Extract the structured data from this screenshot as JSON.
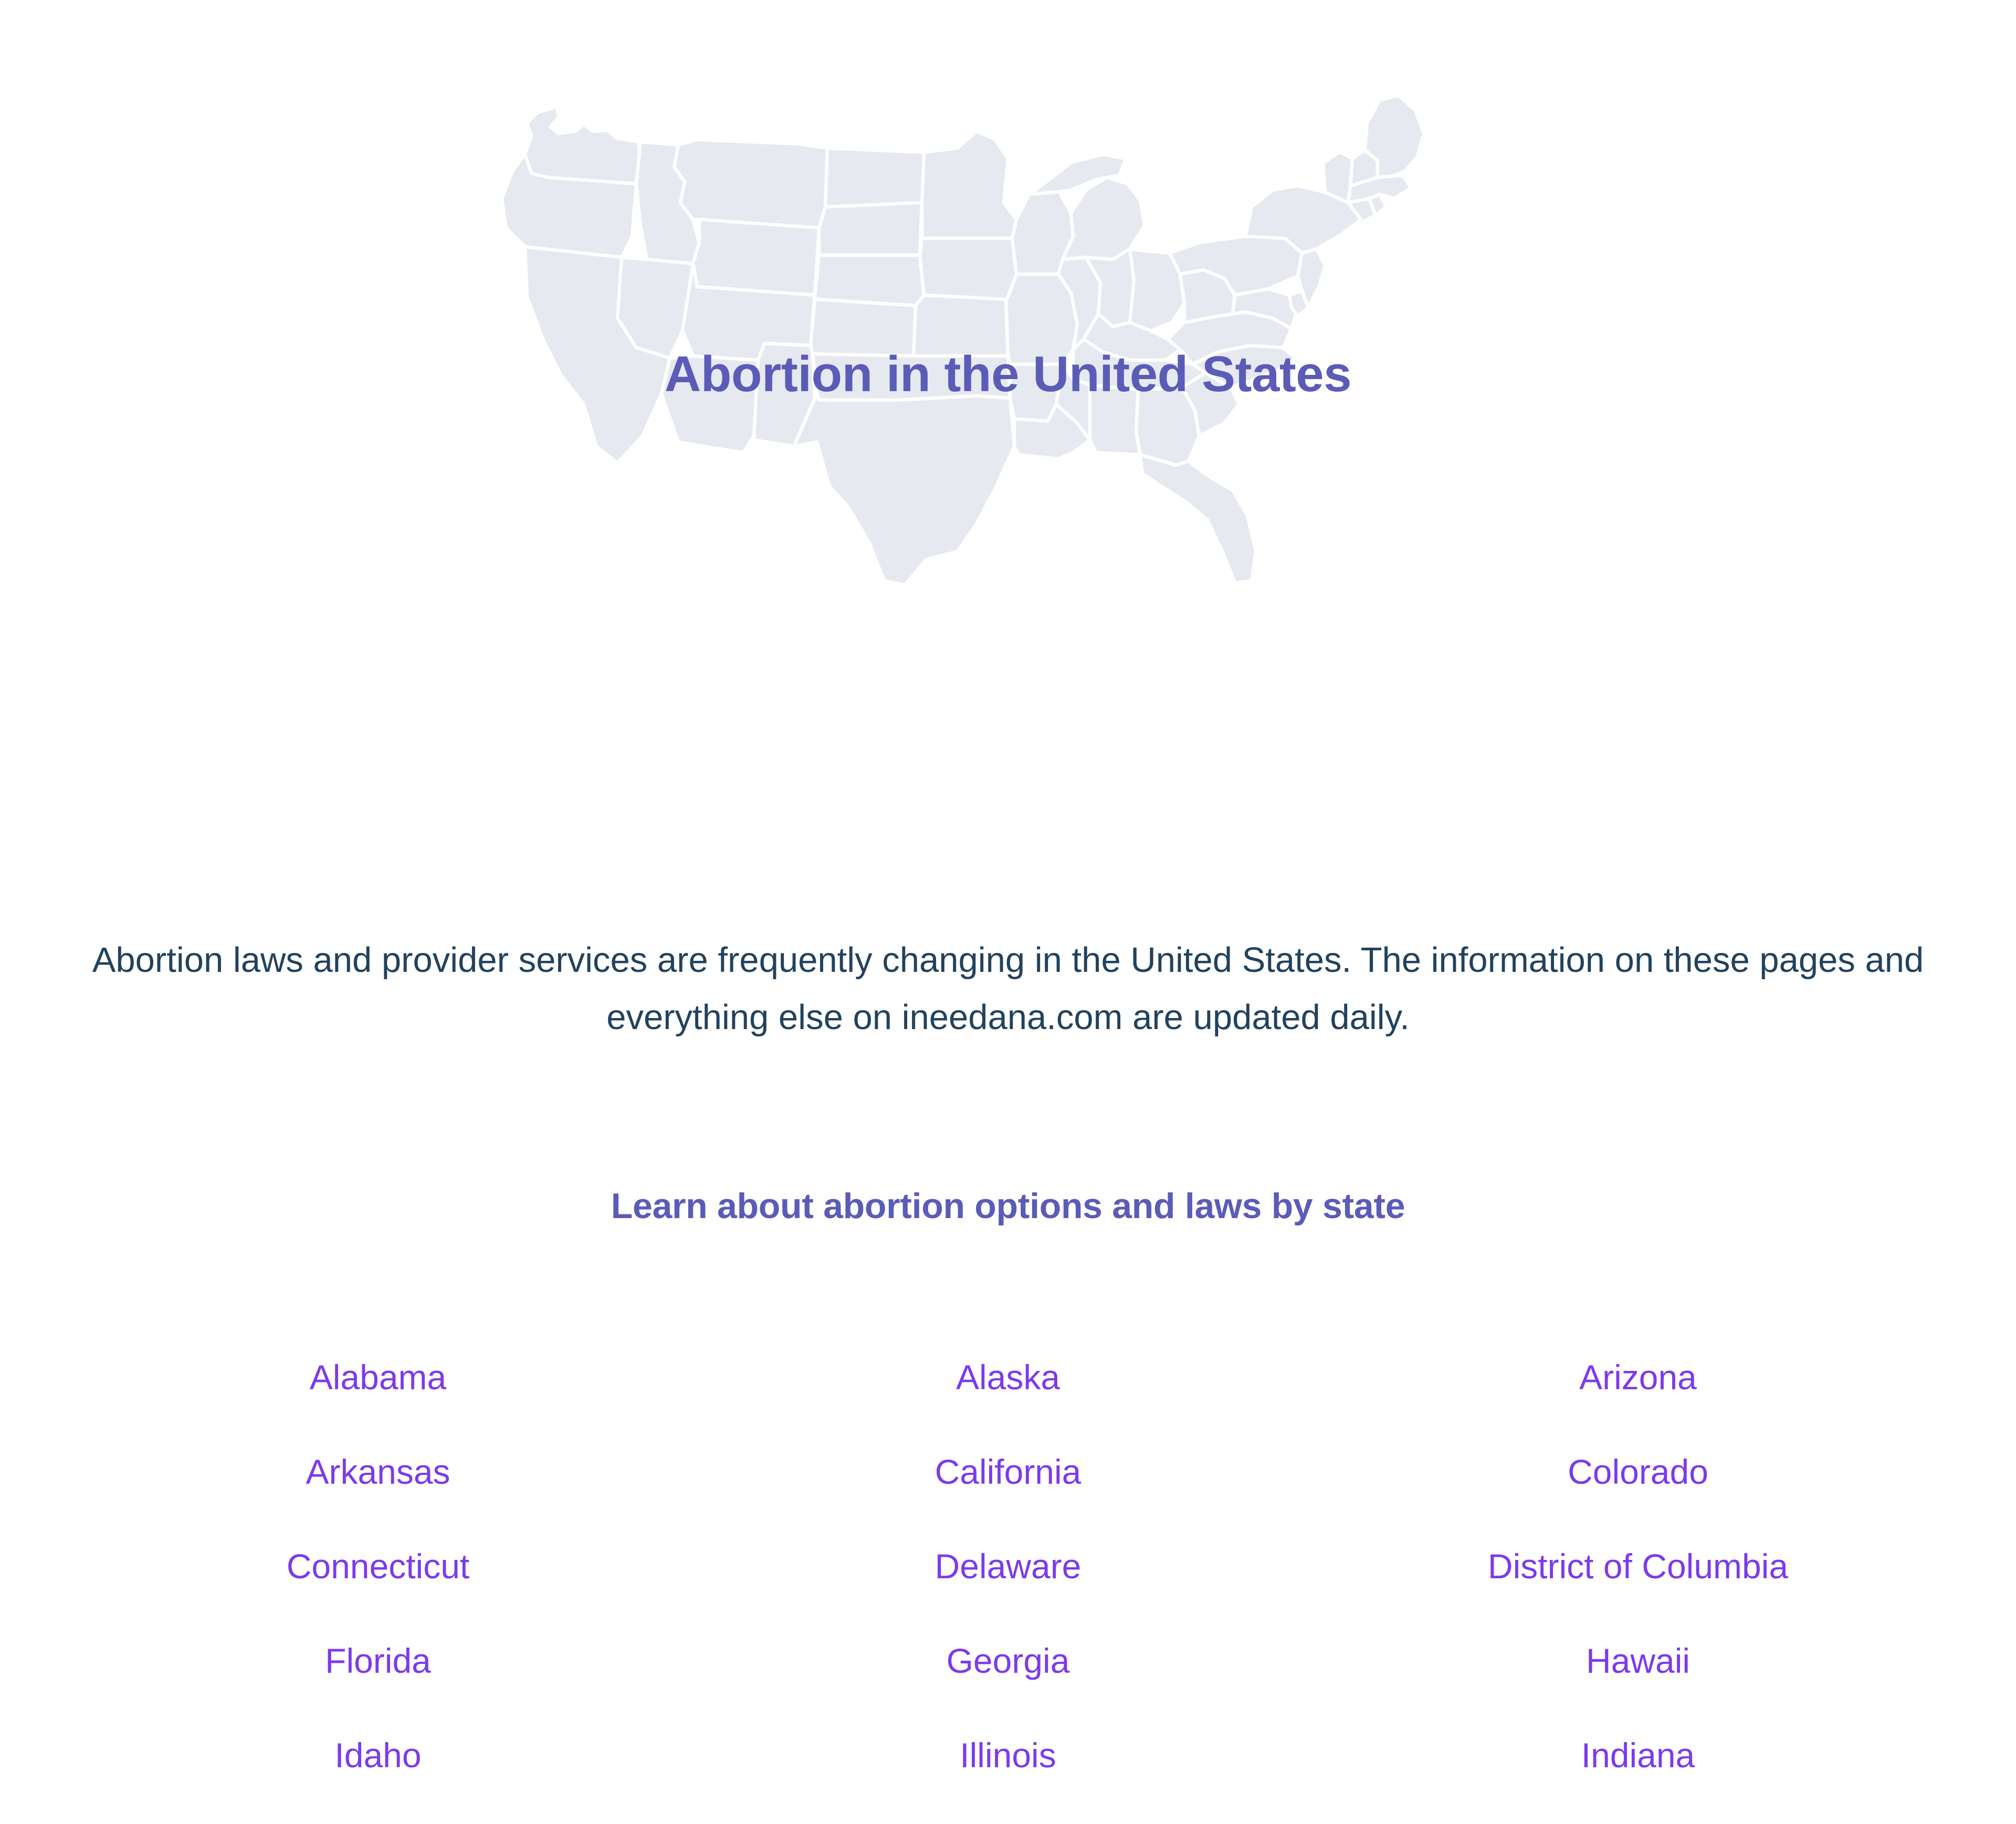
{
  "hero": {
    "title": "Abortion in the United States",
    "map_alt": "us-map-outline",
    "map_fill_color": "#e7e9f0",
    "map_border_color": "#ffffff",
    "title_color": "#5b5bb8"
  },
  "intro": {
    "paragraph": "Abortion laws and provider services are frequently changing in the United States. The information on these pages and everything else on ineedana.com are updated daily."
  },
  "states_section": {
    "heading": "Learn about abortion options and laws by state",
    "heading_color": "#5b5bb8",
    "link_color": "#7c3aed",
    "states": [
      "Alabama",
      "Alaska",
      "Arizona",
      "Arkansas",
      "California",
      "Colorado",
      "Connecticut",
      "Delaware",
      "District of Columbia",
      "Florida",
      "Georgia",
      "Hawaii",
      "Idaho",
      "Illinois",
      "Indiana"
    ]
  }
}
